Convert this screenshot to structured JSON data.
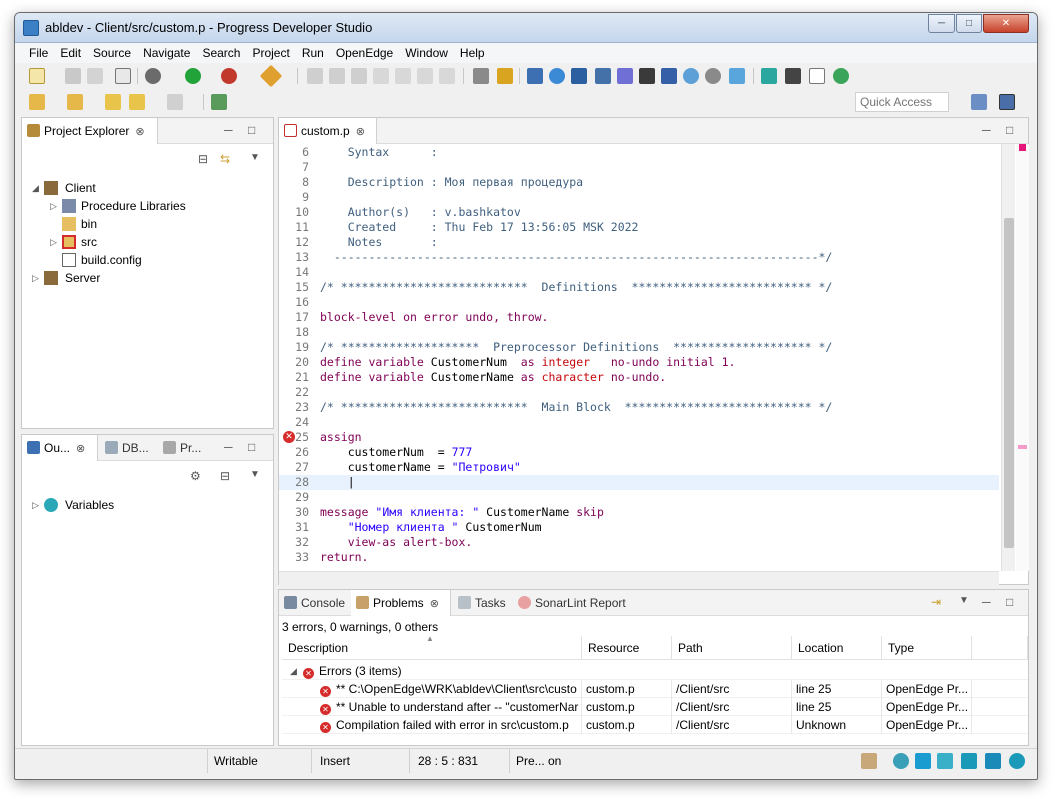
{
  "window": {
    "title": "abldev - Client/src/custom.p - Progress Developer Studio"
  },
  "menu": [
    "File",
    "Edit",
    "Source",
    "Navigate",
    "Search",
    "Project",
    "Run",
    "OpenEdge",
    "Window",
    "Help"
  ],
  "quick_access": {
    "placeholder": "Quick Access"
  },
  "project_explorer": {
    "tab": "Project Explorer",
    "tree": [
      {
        "label": "Client",
        "icon": "project-icon"
      },
      {
        "label": "Procedure Libraries",
        "icon": "library-icon"
      },
      {
        "label": "bin",
        "icon": "folder-icon"
      },
      {
        "label": "src",
        "icon": "source-folder-error-icon"
      },
      {
        "label": "build.config",
        "icon": "config-file-icon"
      },
      {
        "label": "Server",
        "icon": "project-icon"
      }
    ]
  },
  "outline": {
    "tabs": [
      "Ou...",
      "DB...",
      "Pr..."
    ],
    "tree": [
      {
        "label": "Variables",
        "icon": "variables-icon"
      }
    ]
  },
  "editor": {
    "tab": "custom.p",
    "cursor_line": 28,
    "error_line": 25,
    "lines": [
      {
        "n": "6",
        "segs": [
          {
            "t": "    Syntax      :",
            "c": "cm"
          }
        ]
      },
      {
        "n": "7",
        "segs": [
          {
            "t": "",
            "c": "cm"
          }
        ]
      },
      {
        "n": "8",
        "segs": [
          {
            "t": "    Description : Моя первая процедура",
            "c": "cm"
          }
        ]
      },
      {
        "n": "9",
        "segs": [
          {
            "t": "",
            "c": "cm"
          }
        ]
      },
      {
        "n": "10",
        "segs": [
          {
            "t": "    Author(s)   : v.bashkatov",
            "c": "cm"
          }
        ]
      },
      {
        "n": "11",
        "segs": [
          {
            "t": "    Created     : Thu Feb 17 13:56:05 MSK 2022",
            "c": "cm"
          }
        ]
      },
      {
        "n": "12",
        "segs": [
          {
            "t": "    Notes       :",
            "c": "cm"
          }
        ]
      },
      {
        "n": "13",
        "segs": [
          {
            "t": "  ----------------------------------------------------------------------*/",
            "c": "cm"
          }
        ]
      },
      {
        "n": "14",
        "segs": [
          {
            "t": "",
            "c": "cm"
          }
        ]
      },
      {
        "n": "15",
        "segs": [
          {
            "t": "/* ***************************  Definitions  ************************** */",
            "c": "cm"
          }
        ]
      },
      {
        "n": "16",
        "segs": [
          {
            "t": "",
            "c": "cm"
          }
        ]
      },
      {
        "n": "17",
        "segs": [
          {
            "t": "block-level on error undo, throw.",
            "c": "kw"
          }
        ]
      },
      {
        "n": "18",
        "segs": [
          {
            "t": "",
            "c": "cm"
          }
        ]
      },
      {
        "n": "19",
        "segs": [
          {
            "t": "/* ********************  Preprocessor Definitions  ******************** */",
            "c": "cm"
          }
        ]
      },
      {
        "n": "20",
        "segs": [
          {
            "t": "define variable ",
            "c": "kw"
          },
          {
            "t": "CustomerNum  ",
            "c": "id"
          },
          {
            "t": "as ",
            "c": "kw"
          },
          {
            "t": "integer",
            "c": "ty"
          },
          {
            "t": "   no-undo initial 1.",
            "c": "kw"
          }
        ]
      },
      {
        "n": "21",
        "segs": [
          {
            "t": "define variable ",
            "c": "kw"
          },
          {
            "t": "CustomerName ",
            "c": "id"
          },
          {
            "t": "as ",
            "c": "kw"
          },
          {
            "t": "character",
            "c": "ty"
          },
          {
            "t": " no-undo.",
            "c": "kw"
          }
        ]
      },
      {
        "n": "22",
        "segs": [
          {
            "t": "",
            "c": "cm"
          }
        ]
      },
      {
        "n": "23",
        "segs": [
          {
            "t": "/* ***************************  Main Block  *************************** */",
            "c": "cm"
          }
        ]
      },
      {
        "n": "24",
        "segs": [
          {
            "t": "",
            "c": "cm"
          }
        ]
      },
      {
        "n": "25",
        "segs": [
          {
            "t": "assign",
            "c": "kw"
          }
        ]
      },
      {
        "n": "26",
        "segs": [
          {
            "t": "    customerNum  = ",
            "c": "id"
          },
          {
            "t": "777",
            "c": "st"
          }
        ]
      },
      {
        "n": "27",
        "segs": [
          {
            "t": "    customerName = ",
            "c": "id"
          },
          {
            "t": "\"Петрович\"",
            "c": "st"
          }
        ]
      },
      {
        "n": "28",
        "segs": [
          {
            "t": "    |",
            "c": "id"
          }
        ]
      },
      {
        "n": "29",
        "segs": [
          {
            "t": "",
            "c": "cm"
          }
        ]
      },
      {
        "n": "30",
        "segs": [
          {
            "t": "message ",
            "c": "kw"
          },
          {
            "t": "\"Имя клиента: \"",
            "c": "st"
          },
          {
            "t": " CustomerName ",
            "c": "id"
          },
          {
            "t": "skip",
            "c": "kw"
          }
        ]
      },
      {
        "n": "31",
        "segs": [
          {
            "t": "    ",
            "c": "id"
          },
          {
            "t": "\"Номер клиента \"",
            "c": "st"
          },
          {
            "t": " CustomerNum",
            "c": "id"
          }
        ]
      },
      {
        "n": "32",
        "segs": [
          {
            "t": "    view-as alert-box.",
            "c": "kw"
          }
        ]
      },
      {
        "n": "33",
        "segs": [
          {
            "t": "return.",
            "c": "kw"
          }
        ]
      }
    ]
  },
  "bottom_tabs": [
    "Console",
    "Problems",
    "Tasks",
    "SonarLint Report"
  ],
  "problems": {
    "summary": "3 errors, 0 warnings, 0 others",
    "columns": [
      "Description",
      "Resource",
      "Path",
      "Location",
      "Type"
    ],
    "group": "Errors (3 items)",
    "rows": [
      {
        "description": "** C:\\OpenEdge\\WRK\\abldev\\Client\\src\\custo",
        "resource": "custom.p",
        "path": "/Client/src",
        "location": "line 25",
        "type": "OpenEdge Pr..."
      },
      {
        "description": "** Unable to understand after -- \"customerNar",
        "resource": "custom.p",
        "path": "/Client/src",
        "location": "line 25",
        "type": "OpenEdge Pr..."
      },
      {
        "description": "Compilation failed with error in src\\custom.p",
        "resource": "custom.p",
        "path": "/Client/src",
        "location": "Unknown",
        "type": "OpenEdge Pr..."
      }
    ]
  },
  "status": {
    "mode": "Writable",
    "insert": "Insert",
    "position": "28 : 5 : 831",
    "extra": "Pre... on"
  },
  "colors": {
    "keyword": "#7f0055",
    "type": "#c5060b",
    "string": "#2a00ff",
    "comment": "#3f5f7f",
    "error": "#d62b2b",
    "current_line": "#e8f2fe"
  }
}
